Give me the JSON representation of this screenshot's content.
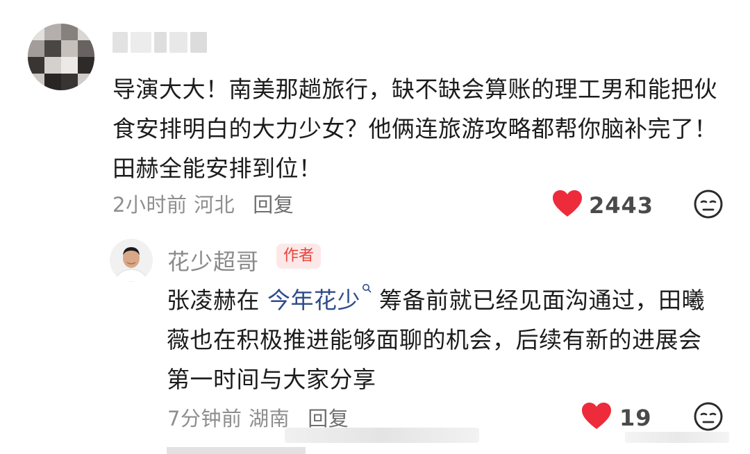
{
  "colors": {
    "heart": "#ee2b3b",
    "badge_bg": "#fde8e8",
    "badge_text": "#e8413b",
    "topic_link": "#2f4c8a"
  },
  "comment": {
    "avatar": "avatar",
    "username": "",
    "text": "导演大大！南美那趟旅行，缺不缺会算账的理工男和能把伙食安排明白的大力少女？他俩连旅游攻略都帮你脑补完了！田赫全能安排到位！",
    "time": "2小时前",
    "location": "河北",
    "reply_label": "回复",
    "like_count": "2443",
    "like_icon": "heart-icon",
    "dislike_icon": "dislike-face-icon"
  },
  "reply": {
    "avatar": "avatar",
    "author": "花少超哥",
    "badge": "作者",
    "text_before": "张凌赫在 ",
    "topic": "今年花少",
    "topic_icon": "search-icon",
    "text_after": " 筹备前就已经见面沟通过，田曦薇也在积极推进能够面聊的机会，后续有新的进展会第一时间与大家分享",
    "time": "7分钟前",
    "location": "湖南",
    "reply_label": "回复",
    "like_count": "19",
    "like_icon": "heart-icon",
    "dislike_icon": "dislike-face-icon"
  }
}
